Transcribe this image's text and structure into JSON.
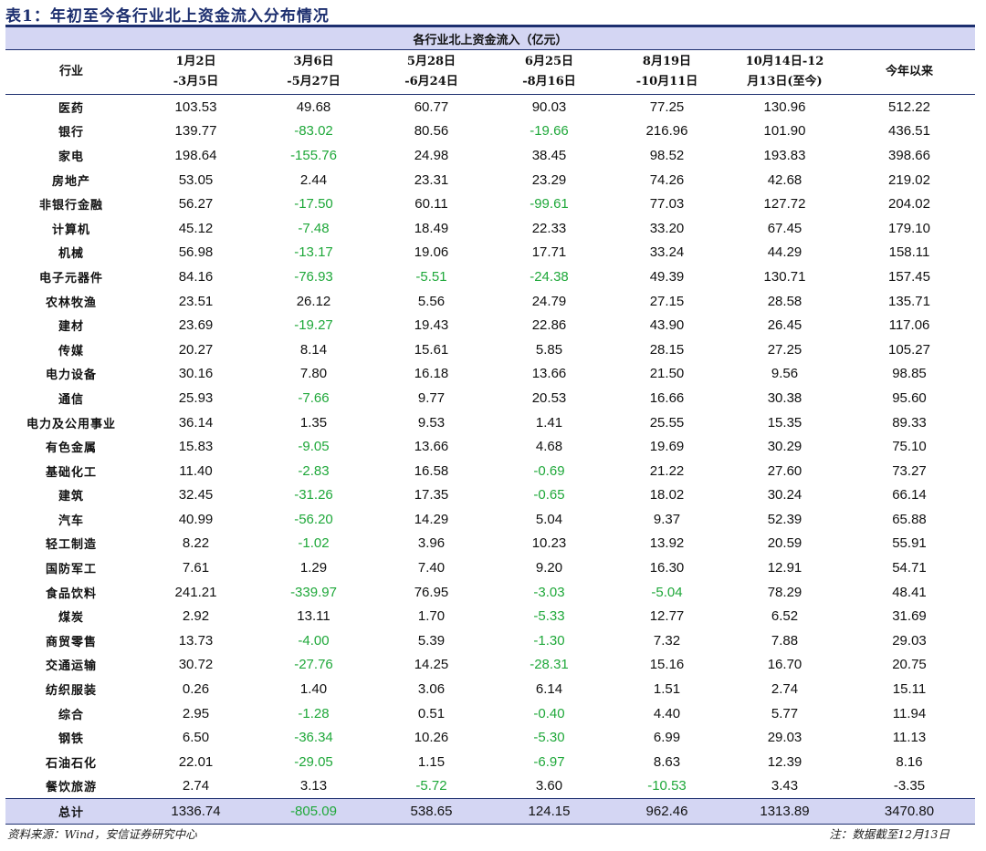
{
  "title": "表1：年初至今各行业北上资金流入分布情况",
  "group_header": "各行业北上资金流入（亿元）",
  "columns": [
    {
      "line1": "行业",
      "line2": ""
    },
    {
      "line1": "1月2日",
      "line2": "-3月5日"
    },
    {
      "line1": "3月6日",
      "line2": "-5月27日"
    },
    {
      "line1": "5月28日",
      "line2": "-6月24日"
    },
    {
      "line1": "6月25日",
      "line2": "-8月16日"
    },
    {
      "line1": "8月19日",
      "line2": "-10月11日"
    },
    {
      "line1": "10月14日-12",
      "line2": "月13日(至今)"
    },
    {
      "line1": "今年以来",
      "line2": ""
    }
  ],
  "rows": [
    [
      "医药",
      "103.53",
      "49.68",
      "60.77",
      "90.03",
      "77.25",
      "130.96",
      "512.22"
    ],
    [
      "银行",
      "139.77",
      "-83.02",
      "80.56",
      "-19.66",
      "216.96",
      "101.90",
      "436.51"
    ],
    [
      "家电",
      "198.64",
      "-155.76",
      "24.98",
      "38.45",
      "98.52",
      "193.83",
      "398.66"
    ],
    [
      "房地产",
      "53.05",
      "2.44",
      "23.31",
      "23.29",
      "74.26",
      "42.68",
      "219.02"
    ],
    [
      "非银行金融",
      "56.27",
      "-17.50",
      "60.11",
      "-99.61",
      "77.03",
      "127.72",
      "204.02"
    ],
    [
      "计算机",
      "45.12",
      "-7.48",
      "18.49",
      "22.33",
      "33.20",
      "67.45",
      "179.10"
    ],
    [
      "机械",
      "56.98",
      "-13.17",
      "19.06",
      "17.71",
      "33.24",
      "44.29",
      "158.11"
    ],
    [
      "电子元器件",
      "84.16",
      "-76.93",
      "-5.51",
      "-24.38",
      "49.39",
      "130.71",
      "157.45"
    ],
    [
      "农林牧渔",
      "23.51",
      "26.12",
      "5.56",
      "24.79",
      "27.15",
      "28.58",
      "135.71"
    ],
    [
      "建材",
      "23.69",
      "-19.27",
      "19.43",
      "22.86",
      "43.90",
      "26.45",
      "117.06"
    ],
    [
      "传媒",
      "20.27",
      "8.14",
      "15.61",
      "5.85",
      "28.15",
      "27.25",
      "105.27"
    ],
    [
      "电力设备",
      "30.16",
      "7.80",
      "16.18",
      "13.66",
      "21.50",
      "9.56",
      "98.85"
    ],
    [
      "通信",
      "25.93",
      "-7.66",
      "9.77",
      "20.53",
      "16.66",
      "30.38",
      "95.60"
    ],
    [
      "电力及公用事业",
      "36.14",
      "1.35",
      "9.53",
      "1.41",
      "25.55",
      "15.35",
      "89.33"
    ],
    [
      "有色金属",
      "15.83",
      "-9.05",
      "13.66",
      "4.68",
      "19.69",
      "30.29",
      "75.10"
    ],
    [
      "基础化工",
      "11.40",
      "-2.83",
      "16.58",
      "-0.69",
      "21.22",
      "27.60",
      "73.27"
    ],
    [
      "建筑",
      "32.45",
      "-31.26",
      "17.35",
      "-0.65",
      "18.02",
      "30.24",
      "66.14"
    ],
    [
      "汽车",
      "40.99",
      "-56.20",
      "14.29",
      "5.04",
      "9.37",
      "52.39",
      "65.88"
    ],
    [
      "轻工制造",
      "8.22",
      "-1.02",
      "3.96",
      "10.23",
      "13.92",
      "20.59",
      "55.91"
    ],
    [
      "国防军工",
      "7.61",
      "1.29",
      "7.40",
      "9.20",
      "16.30",
      "12.91",
      "54.71"
    ],
    [
      "食品饮料",
      "241.21",
      "-339.97",
      "76.95",
      "-3.03",
      "-5.04",
      "78.29",
      "48.41"
    ],
    [
      "煤炭",
      "2.92",
      "13.11",
      "1.70",
      "-5.33",
      "12.77",
      "6.52",
      "31.69"
    ],
    [
      "商贸零售",
      "13.73",
      "-4.00",
      "5.39",
      "-1.30",
      "7.32",
      "7.88",
      "29.03"
    ],
    [
      "交通运输",
      "30.72",
      "-27.76",
      "14.25",
      "-28.31",
      "15.16",
      "16.70",
      "20.75"
    ],
    [
      "纺织服装",
      "0.26",
      "1.40",
      "3.06",
      "6.14",
      "1.51",
      "2.74",
      "15.11"
    ],
    [
      "综合",
      "2.95",
      "-1.28",
      "0.51",
      "-0.40",
      "4.40",
      "5.77",
      "11.94"
    ],
    [
      "钢铁",
      "6.50",
      "-36.34",
      "10.26",
      "-5.30",
      "6.99",
      "29.03",
      "11.13"
    ],
    [
      "石油石化",
      "22.01",
      "-29.05",
      "1.15",
      "-6.97",
      "8.63",
      "12.39",
      "8.16"
    ],
    [
      "餐饮旅游",
      "2.74",
      "3.13",
      "-5.72",
      "3.60",
      "-10.53",
      "3.43",
      "-3.35"
    ]
  ],
  "total": [
    "总计",
    "1336.74",
    "-805.09",
    "538.65",
    "124.15",
    "962.46",
    "1313.89",
    "3470.80"
  ],
  "footer": {
    "source": "资料来源：Wind，安信证券研究中心",
    "note": "注：数据截至12月13日"
  },
  "colors": {
    "negative": "#1fa83a",
    "header_fill": "#d4d6f3",
    "rule": "#1d2f6f"
  }
}
